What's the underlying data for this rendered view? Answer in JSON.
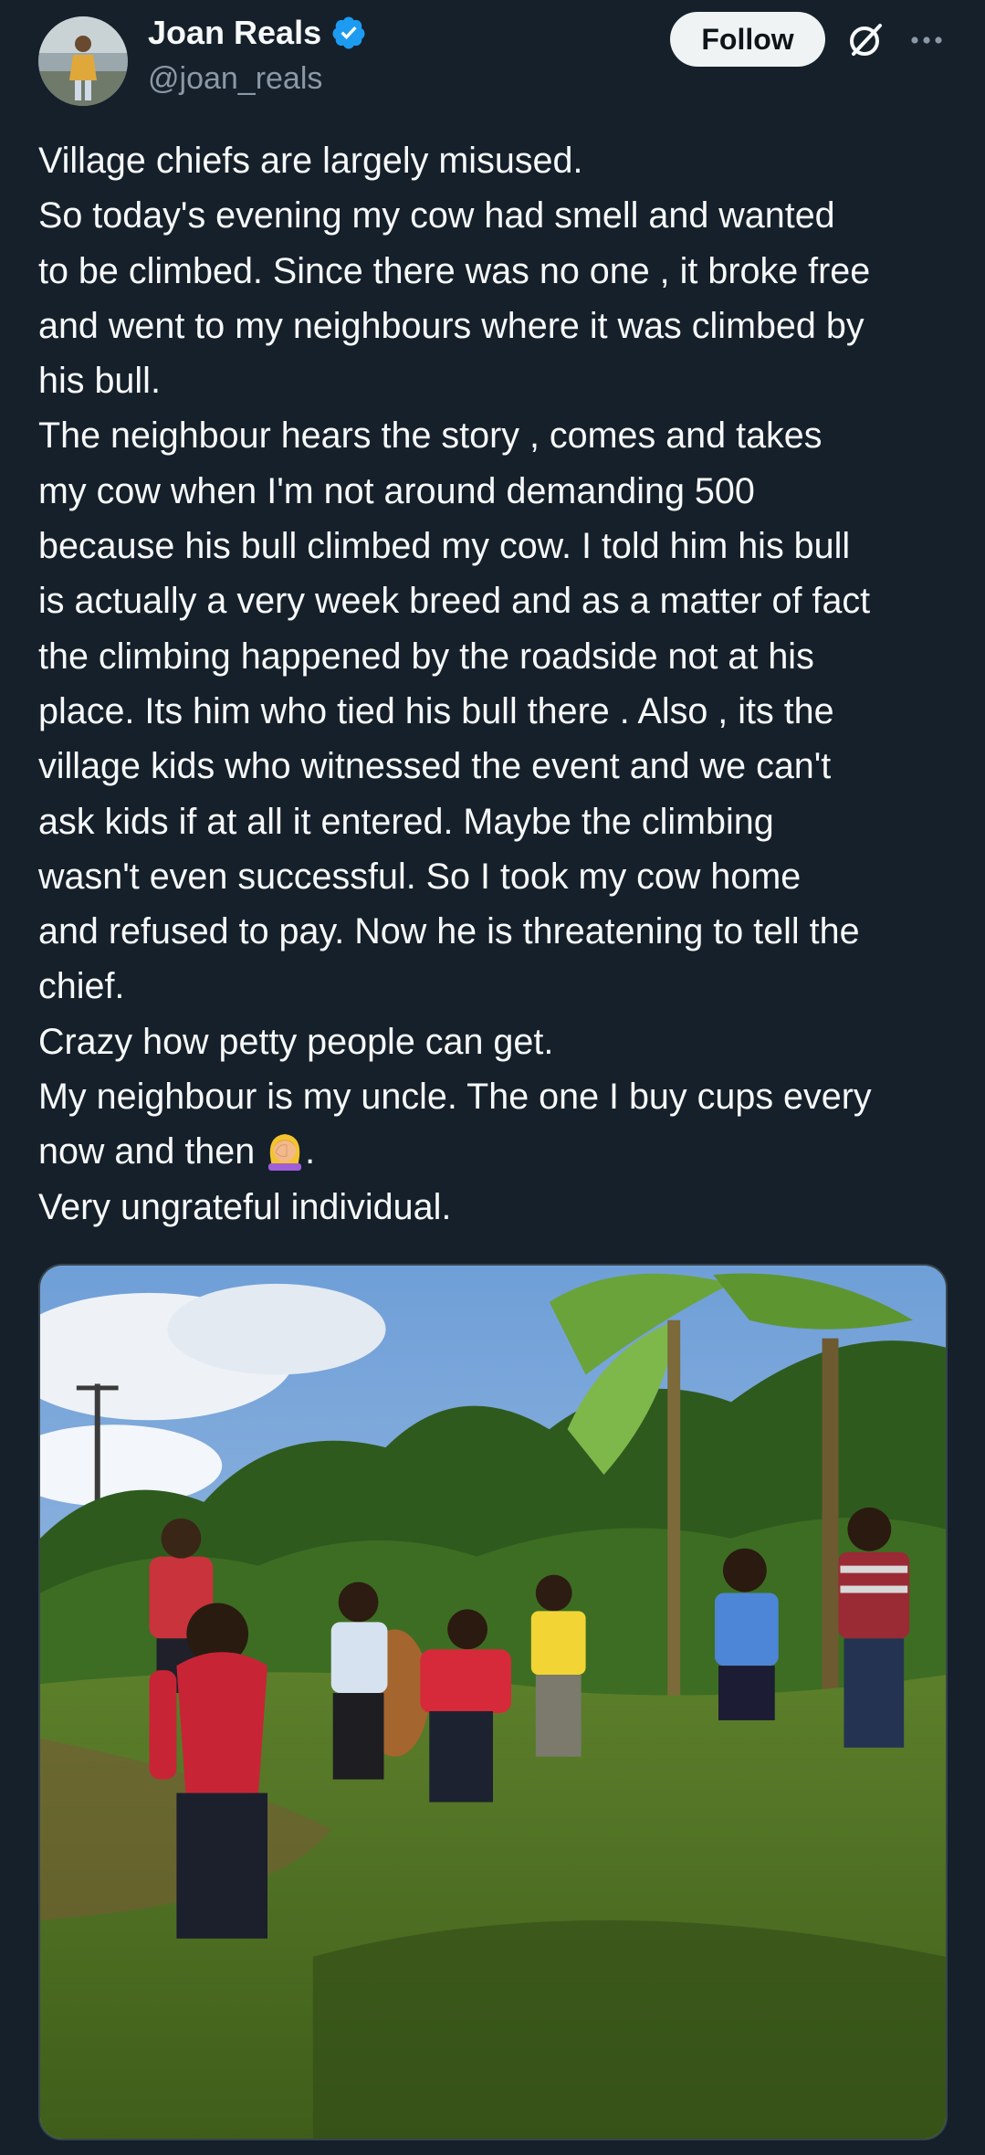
{
  "author": {
    "display_name": "Joan Reals",
    "handle": "@joan_reals",
    "verified": true,
    "avatar_icon": "avatar-photo"
  },
  "header": {
    "follow_label": "Follow",
    "grok_icon": "grok-icon",
    "more_icon": "more-icon"
  },
  "tweet": {
    "lines": [
      "Village chiefs are largely misused.",
      "So today's evening my cow had smell and wanted",
      "to be climbed. Since there was no one , it broke free",
      "and went to my neighbours where it was climbed by",
      "his bull.",
      "The neighbour hears the story , comes and takes",
      "my cow when I'm not around demanding 500",
      "because his bull climbed my cow. I told him his bull",
      "is actually a very week breed and as a matter of fact",
      "the climbing happened by the roadside not at his",
      "place. Its him who tied his bull there . Also , its the",
      "village kids who witnessed the event and we can't",
      "ask kids if at all it entered. Maybe the climbing",
      "wasn't even successful.  So I took my cow home",
      "and refused to pay. Now he is threatening to tell the",
      "chief.",
      "Crazy how petty people can get.",
      "My neighbour is my uncle.  The one I buy cups every"
    ],
    "line_emoji_prefix": "now and then ",
    "line_emoji_suffix": ".",
    "emoji_icon": "woman-facepalming-emoji",
    "last_line": "Very ungrateful individual."
  },
  "media": {
    "type": "photo",
    "description_icon": "photo-children-chasing-cow"
  },
  "colors": {
    "background": "#15202b",
    "text": "#f7f9f9",
    "secondary_text": "#8b98a5",
    "verified_blue": "#1d9bf0",
    "follow_bg": "#eff3f4"
  }
}
